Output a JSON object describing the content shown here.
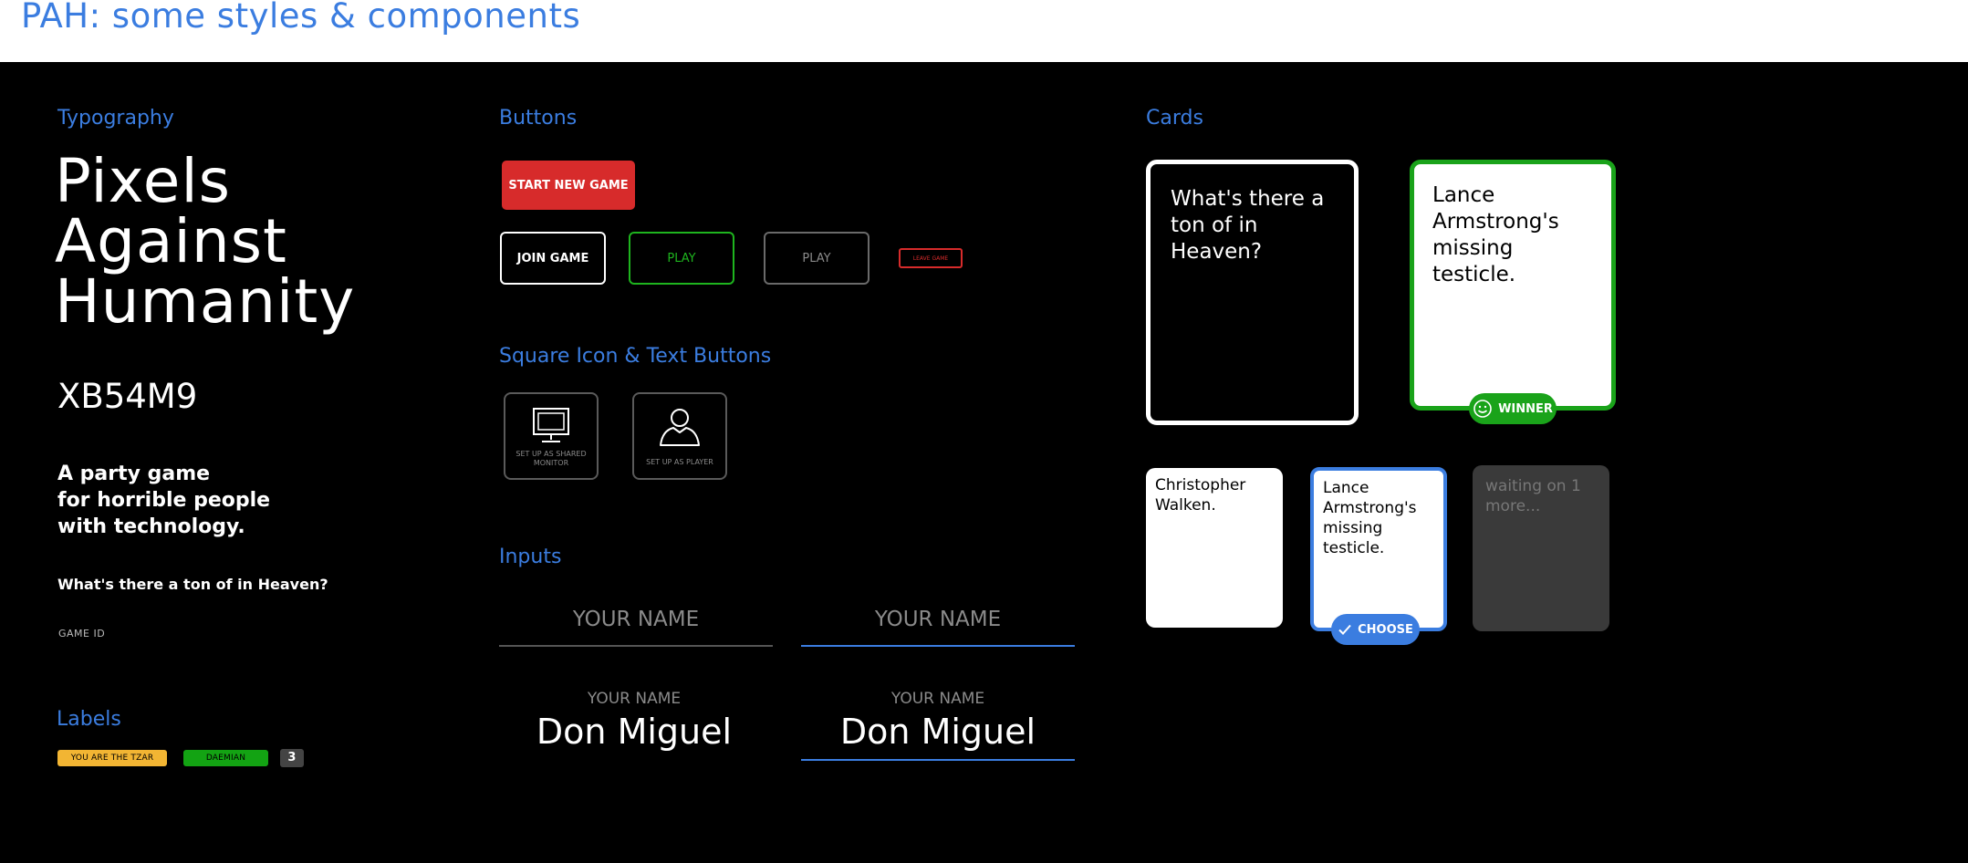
{
  "header": {
    "title": "PAH: some styles & components"
  },
  "sections": {
    "typography": "Typography",
    "buttons": "Buttons",
    "cards": "Cards",
    "square_buttons": "Square Icon & Text Buttons",
    "inputs": "Inputs",
    "labels": "Labels"
  },
  "typography": {
    "hero_lines": [
      "Pixels",
      "Against",
      "Humanity"
    ],
    "game_id": "XB54M9",
    "tagline_lines": [
      "A party game",
      "for horrible people",
      "with technology."
    ],
    "question": "What's there a ton of in Heaven?",
    "game_id_label": "GAME ID"
  },
  "labels": {
    "tzar": "YOU ARE THE TZAR",
    "player": "DAEMIAN",
    "count": "3"
  },
  "buttons": {
    "start_new_game": "START NEW GAME",
    "join_game": "JOIN GAME",
    "play_green": "PLAY",
    "play_gray": "PLAY",
    "leave_game": "LEAVE GAME"
  },
  "square_buttons": {
    "shared_monitor": "SET UP AS SHARED MONITOR",
    "player": "SET UP AS PLAYER"
  },
  "inputs": {
    "placeholder_1": "YOUR NAME",
    "placeholder_2": "YOUR NAME",
    "label_1": "YOUR NAME",
    "value_1": "Don Miguel",
    "label_2": "YOUR NAME",
    "value_2": "Don Miguel"
  },
  "cards": {
    "black_card": "What's there a ton of in Heaven?",
    "winner_card": "Lance Armstrong's missing testicle.",
    "winner_badge": "WINNER",
    "white_card": "Christopher Walken.",
    "selected_card": "Lance Armstrong's missing testicle.",
    "choose_badge": "CHOOSE",
    "waiting_card": "waiting on 1 more..."
  },
  "colors": {
    "accent_blue": "#3b7de0",
    "red": "#d72b2b",
    "green": "#1eb41e",
    "yellow": "#f2b533",
    "gray": "#6a6a6a"
  }
}
